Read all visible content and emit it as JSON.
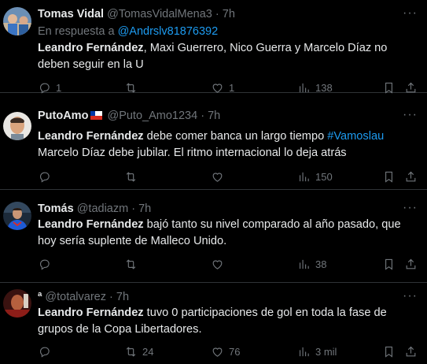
{
  "tweets": [
    {
      "name": "Tomas Vidal",
      "handle": "@TomasVidalMena3",
      "sep": "·",
      "time": "7h",
      "reply_prefix": "En respuesta a",
      "reply_to": "@Andrslv81876392",
      "text_bold": "Leandro Fernández",
      "text_rest": ", Maxi Guerrero, Nico Guerra y Marcelo Díaz no deben seguir en la U",
      "replies": "1",
      "retweets": "",
      "likes": "1",
      "views": "138"
    },
    {
      "name": "PutoAmo",
      "flag": "chile-flag",
      "handle": "@Puto_Amo1234",
      "sep": "·",
      "time": "7h",
      "text_bold": "Leandro Fernández",
      "text_rest": " debe comer banca un largo tiempo ",
      "hashtag": "#Vamoslau",
      "text_line2": "Marcelo Díaz debe jubilar. El ritmo internacional lo deja atrás",
      "replies": "",
      "retweets": "",
      "likes": "",
      "views": "150"
    },
    {
      "name": "Tomás",
      "handle": "@tadiazm",
      "sep": "·",
      "time": "7h",
      "text_bold": "Leandro Fernández",
      "text_rest": " bajó tanto su nivel comparado al año pasado, que hoy sería suplente de Malleco Unido.",
      "replies": "",
      "retweets": "",
      "likes": "",
      "views": "38"
    },
    {
      "name": "ª",
      "handle": "@totalvarez",
      "sep": "·",
      "time": "7h",
      "text_bold": "Leandro Fernández",
      "text_rest": " tuvo 0 participaciones de gol en toda la fase de grupos de la Copa Libertadores.",
      "replies": "",
      "retweets": "24",
      "likes": "76",
      "views": "3 mil"
    }
  ],
  "more_glyph": "···",
  "colors": {
    "accent": "#1d9bf0",
    "muted": "#71767b",
    "text": "#e7e9ea",
    "divider": "#2f3336"
  }
}
